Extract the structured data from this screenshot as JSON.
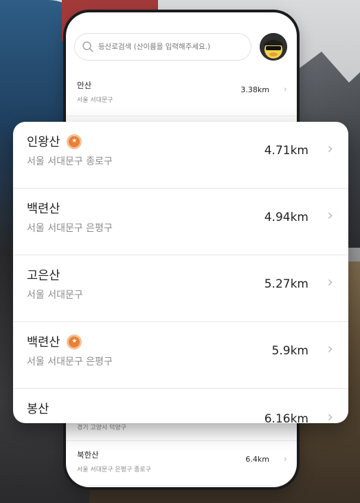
{
  "search": {
    "placeholder": "등산로검색 (산이름을 입력해주세요.)"
  },
  "back_list": {
    "top_item": {
      "name": "안산",
      "address": "서울 서대문구",
      "distance": "3.38km"
    },
    "partial_item": {
      "address": "경기 고양시 덕양구"
    },
    "bottom_item": {
      "name": "북한산",
      "address": "서울 서대문구 은평구 종로구",
      "distance": "6.4km"
    }
  },
  "card": {
    "rows": [
      {
        "name": "인왕산",
        "address": "서울 서대문구 종로구",
        "distance": "4.71km",
        "badge": true
      },
      {
        "name": "백련산",
        "address": "서울 서대문구 은평구",
        "distance": "4.94km",
        "badge": false
      },
      {
        "name": "고은산",
        "address": "서울 서대문구",
        "distance": "5.27km",
        "badge": false
      },
      {
        "name": "백련산",
        "address": "서울 서대문구 은평구",
        "distance": "5.9km",
        "badge": true
      },
      {
        "name": "봉산",
        "address": "",
        "distance": "6.16km",
        "badge": false
      }
    ]
  },
  "icons": {
    "chevron": "chevron-right-icon",
    "search": "search-icon",
    "badge": "certified-badge-icon"
  },
  "colors": {
    "badge_orange": "#e98033",
    "text_primary": "#222222",
    "text_secondary": "#8c8c8c",
    "chevron": "#bdbdbd"
  }
}
